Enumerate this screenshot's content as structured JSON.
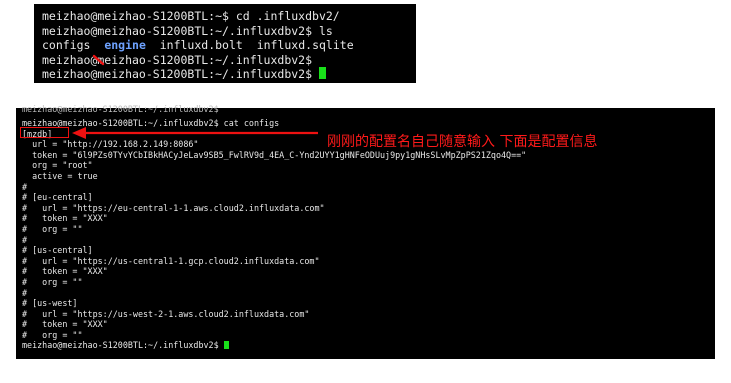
{
  "terminal_top": {
    "lines": [
      "meizhao@meizhao-S1200BTL:~$ cd .influxdbv2/",
      "meizhao@meizhao-S1200BTL:~/.influxdbv2$ ls"
    ],
    "ls_output": {
      "configs": "configs",
      "engine": "engine",
      "influxd_bolt": "influxd.bolt",
      "influxd_sqlite": "influxd.sqlite"
    },
    "prompt_line": "meizhao@meizhao-S1200BTL:~/.influxdbv2$",
    "last_prompt": "meizhao@meizhao-S1200BTL:~/.influxdbv2$ "
  },
  "terminal_bottom": {
    "cut_top": "meizhao@meizhao-S1200BTL:~/.influxdbv2$",
    "command_line": "meizhao@meizhao-S1200BTL:~/.influxdbv2$ cat configs",
    "lines": [
      "[mzdb]",
      "  url = \"http://192.168.2.149:8086\"",
      "  token = \"6l9PZs0TYvYCbIBkHACyJeLav9SB5_FwlRV9d_4EA_C-Ynd2UYY1gHNFeODUuj9py1gNHsSLvMpZpPS21Zqo4Q==\"",
      "  org = \"root\"",
      "  active = true",
      "#",
      "# [eu-central]",
      "#   url = \"https://eu-central-1-1.aws.cloud2.influxdata.com\"",
      "#   token = \"XXX\"",
      "#   org = \"\"",
      "#",
      "# [us-central]",
      "#   url = \"https://us-central1-1.gcp.cloud2.influxdata.com\"",
      "#   token = \"XXX\"",
      "#   org = \"\"",
      "#",
      "# [us-west]",
      "#   url = \"https://us-west-2-1.aws.cloud2.influxdata.com\"",
      "#   token = \"XXX\"",
      "#   org = \"\""
    ],
    "last_prompt": "meizhao@meizhao-S1200BTL:~/.influxdbv2$ "
  },
  "annotation": {
    "text": "刚刚的配置名自己随意输入 下面是配置信息",
    "color": "#ff1a1a"
  },
  "colors": {
    "terminal_bg": "#000000",
    "terminal_fg": "#e8e8e8",
    "directory_blue": "#6ea2ff",
    "cursor_green": "#19e01a",
    "annotation_red": "#ee1111"
  }
}
